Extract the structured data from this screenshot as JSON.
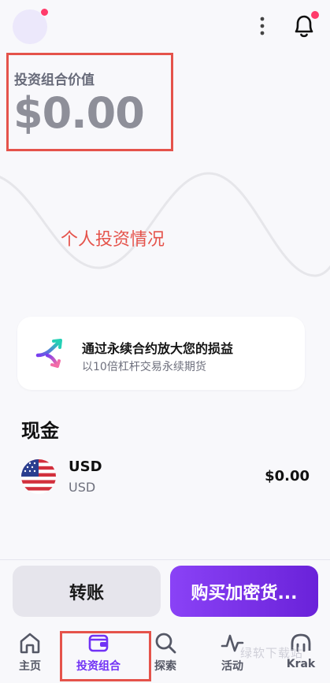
{
  "header": {
    "avatar": "avatar",
    "menu_icon": "kebab-menu-icon",
    "notification_icon": "bell-icon"
  },
  "portfolio": {
    "label": "投资组合价值",
    "value": "$0.00"
  },
  "annotation_text": "个人投资情况",
  "promo": {
    "title": "通过永续合约放大您的损益",
    "subtitle": "以10倍杠杆交易永续期货"
  },
  "cash": {
    "section_title": "现金",
    "items": [
      {
        "code": "USD",
        "name": "USD",
        "amount": "$0.00",
        "icon": "us-flag-icon"
      }
    ]
  },
  "actions": {
    "transfer_label": "转账",
    "buy_label": "购买加密货..."
  },
  "nav": {
    "items": [
      {
        "label": "主页",
        "icon": "home-icon"
      },
      {
        "label": "投资组合",
        "icon": "wallet-icon",
        "active": true
      },
      {
        "label": "探索",
        "icon": "search-icon"
      },
      {
        "label": "活动",
        "icon": "activity-icon"
      },
      {
        "label": "Krak",
        "icon": "krak-icon"
      }
    ]
  },
  "watermark": "绿软下载站",
  "colors": {
    "accent": "#7132f5",
    "highlight_box": "#e5534b",
    "notification_dot": "#ff3b6b",
    "background": "#f8f8fb"
  }
}
